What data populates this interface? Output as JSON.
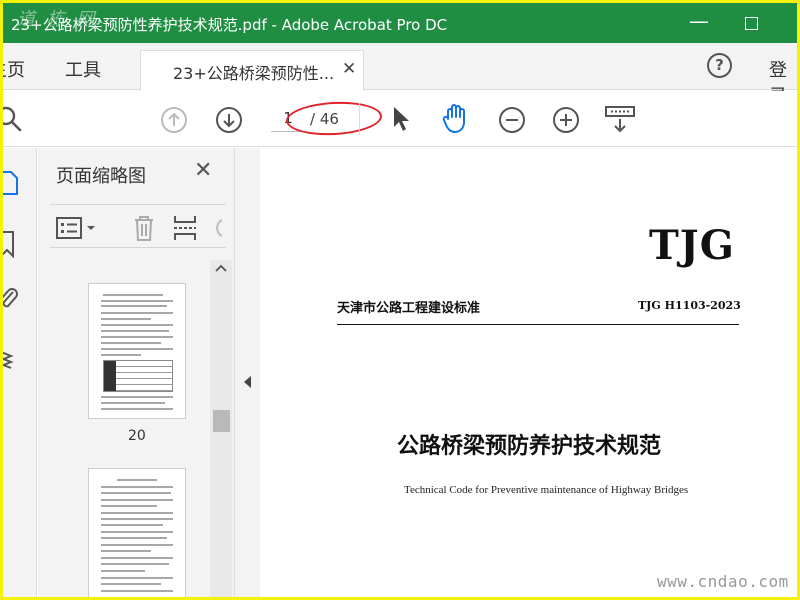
{
  "window": {
    "title": "23+公路桥梁预防性养护技术规范.pdf - Adobe Acrobat Pro DC",
    "corner_watermark": "道 栋 网"
  },
  "menu": {
    "home": "主页",
    "tools": "工具",
    "tab_label": "23+公路桥梁预防性...",
    "login": "登录"
  },
  "toolbar": {
    "page_current": "1",
    "page_total": "/ 46"
  },
  "thumbnails": {
    "title": "页面缩略图",
    "page_numbers": [
      "20"
    ]
  },
  "document": {
    "logo": "TJG",
    "standard_name": "天津市公路工程建设标准",
    "standard_code": "TJG H1103-2023",
    "title": "公路桥梁预防养护技术规范",
    "subtitle": "Technical Code for Preventive maintenance of Highway Bridges",
    "watermark": "www.cndao.com"
  },
  "colors": {
    "titlebar": "#1f8e43",
    "frame": "#f4f206",
    "annotation_oval": "#e3222b",
    "hand_tool_active": "#1473e6"
  }
}
